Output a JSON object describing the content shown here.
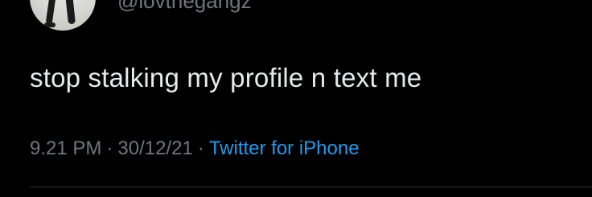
{
  "tweet": {
    "handle": "@lovthegangz",
    "text": "stop stalking my profile n text me",
    "time": "9.21 PM",
    "separator": "·",
    "date": "30/12/21",
    "source": "Twitter for iPhone"
  },
  "colors": {
    "background": "#000000",
    "text": "#e7e9ea",
    "muted": "#71767b",
    "link": "#1d9bf0"
  }
}
